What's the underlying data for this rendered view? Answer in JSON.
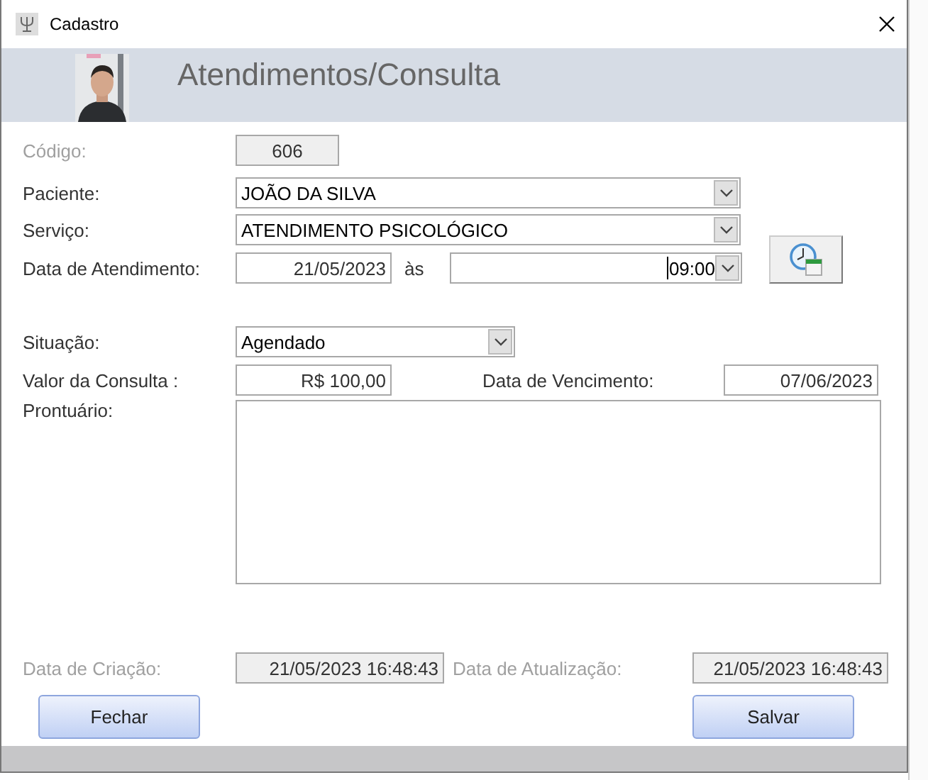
{
  "window": {
    "title": "Cadastro"
  },
  "header": {
    "title": "Atendimentos/Consulta"
  },
  "codigo": {
    "label": "Código:",
    "value": "606",
    "disabled": true
  },
  "paciente": {
    "label": "Paciente:",
    "value": "JOÃO DA SILVA"
  },
  "servico": {
    "label": "Serviço:",
    "value": "ATENDIMENTO PSICOLÓGICO"
  },
  "atendimento": {
    "label": "Data de Atendimento:",
    "date": "21/05/2023",
    "separator": "às",
    "time": "09:00"
  },
  "situacao": {
    "label": "Situação:",
    "value": "Agendado"
  },
  "valor": {
    "label": "Valor da Consulta :",
    "value": "R$ 100,00"
  },
  "vencimento": {
    "label": "Data de Vencimento:",
    "value": "07/06/2023"
  },
  "prontuario": {
    "label": "Prontuário:"
  },
  "criacao": {
    "label": "Data de Criação:",
    "value": "21/05/2023 16:48:43",
    "disabled": true
  },
  "atualizacao": {
    "label": "Data de Atualização:",
    "value": "21/05/2023 16:48:43",
    "disabled": true
  },
  "buttons": [
    {
      "label": "Fechar"
    },
    {
      "label": "Salvar"
    }
  ]
}
